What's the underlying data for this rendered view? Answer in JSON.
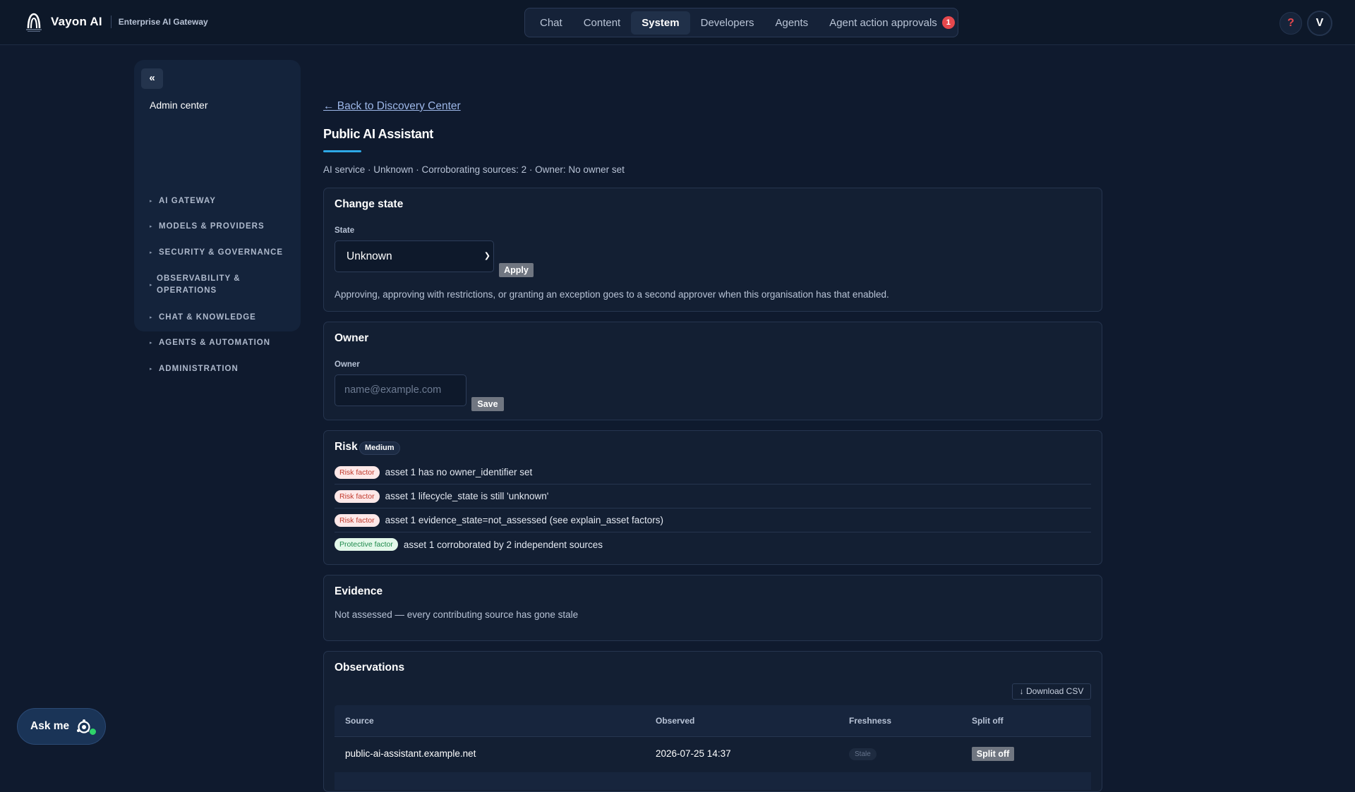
{
  "brand": {
    "name": "Vayon AI",
    "subtitle": "Enterprise AI Gateway"
  },
  "topnav": {
    "items": [
      {
        "label": "Chat"
      },
      {
        "label": "Content"
      },
      {
        "label": "System",
        "active": true
      },
      {
        "label": "Developers"
      },
      {
        "label": "Agents"
      },
      {
        "label": "Agent action approvals",
        "badge": "1"
      }
    ],
    "help_label": "?",
    "avatar_initial": "V"
  },
  "sidebar": {
    "collapse_label": "«",
    "title": "Admin center",
    "items": [
      {
        "label": "AI Gateway"
      },
      {
        "label": "Models & Providers"
      },
      {
        "label": "Security & Governance"
      },
      {
        "label": "Observability & Operations"
      },
      {
        "label": "Chat & Knowledge"
      },
      {
        "label": "Agents & Automation"
      },
      {
        "label": "Administration"
      }
    ]
  },
  "page": {
    "back_link": "← Back to Discovery Center",
    "title": "Public AI Assistant",
    "meta": "AI service · Unknown · Corroborating sources: 2 · Owner: No owner set"
  },
  "change_state": {
    "title": "Change state",
    "field_label": "State",
    "selected": "Unknown",
    "apply_label": "Apply",
    "note": "Approving, approving with restrictions, or granting an exception goes to a second approver when this organisation has that enabled."
  },
  "owner": {
    "title": "Owner",
    "field_label": "Owner",
    "placeholder": "name@example.com",
    "save_label": "Save"
  },
  "risk": {
    "title": "Risk",
    "level": "Medium",
    "factors": [
      {
        "tag": "Risk factor",
        "kind": "risk",
        "text": "asset 1 has no owner_identifier set"
      },
      {
        "tag": "Risk factor",
        "kind": "risk",
        "text": "asset 1 lifecycle_state is still 'unknown'"
      },
      {
        "tag": "Risk factor",
        "kind": "risk",
        "text": "asset 1 evidence_state=not_assessed (see explain_asset factors)"
      },
      {
        "tag": "Protective factor",
        "kind": "protective",
        "text": "asset 1 corroborated by 2 independent sources"
      }
    ]
  },
  "evidence": {
    "title": "Evidence",
    "text": "Not assessed — every contributing source has gone stale"
  },
  "observations": {
    "title": "Observations",
    "download_label": "↓ Download CSV",
    "columns": [
      "Source",
      "Observed",
      "Freshness",
      "Split off"
    ],
    "rows": [
      {
        "source": "public-ai-assistant.example.net",
        "observed": "2026-07-25 14:37",
        "freshness": "Stale",
        "action": "Split off"
      }
    ]
  },
  "ask_me": {
    "label": "Ask me"
  },
  "colors": {
    "background": "#0f1a2e",
    "accent": "#2ea8e6",
    "danger": "#e5484d",
    "success": "#2fd46a"
  }
}
